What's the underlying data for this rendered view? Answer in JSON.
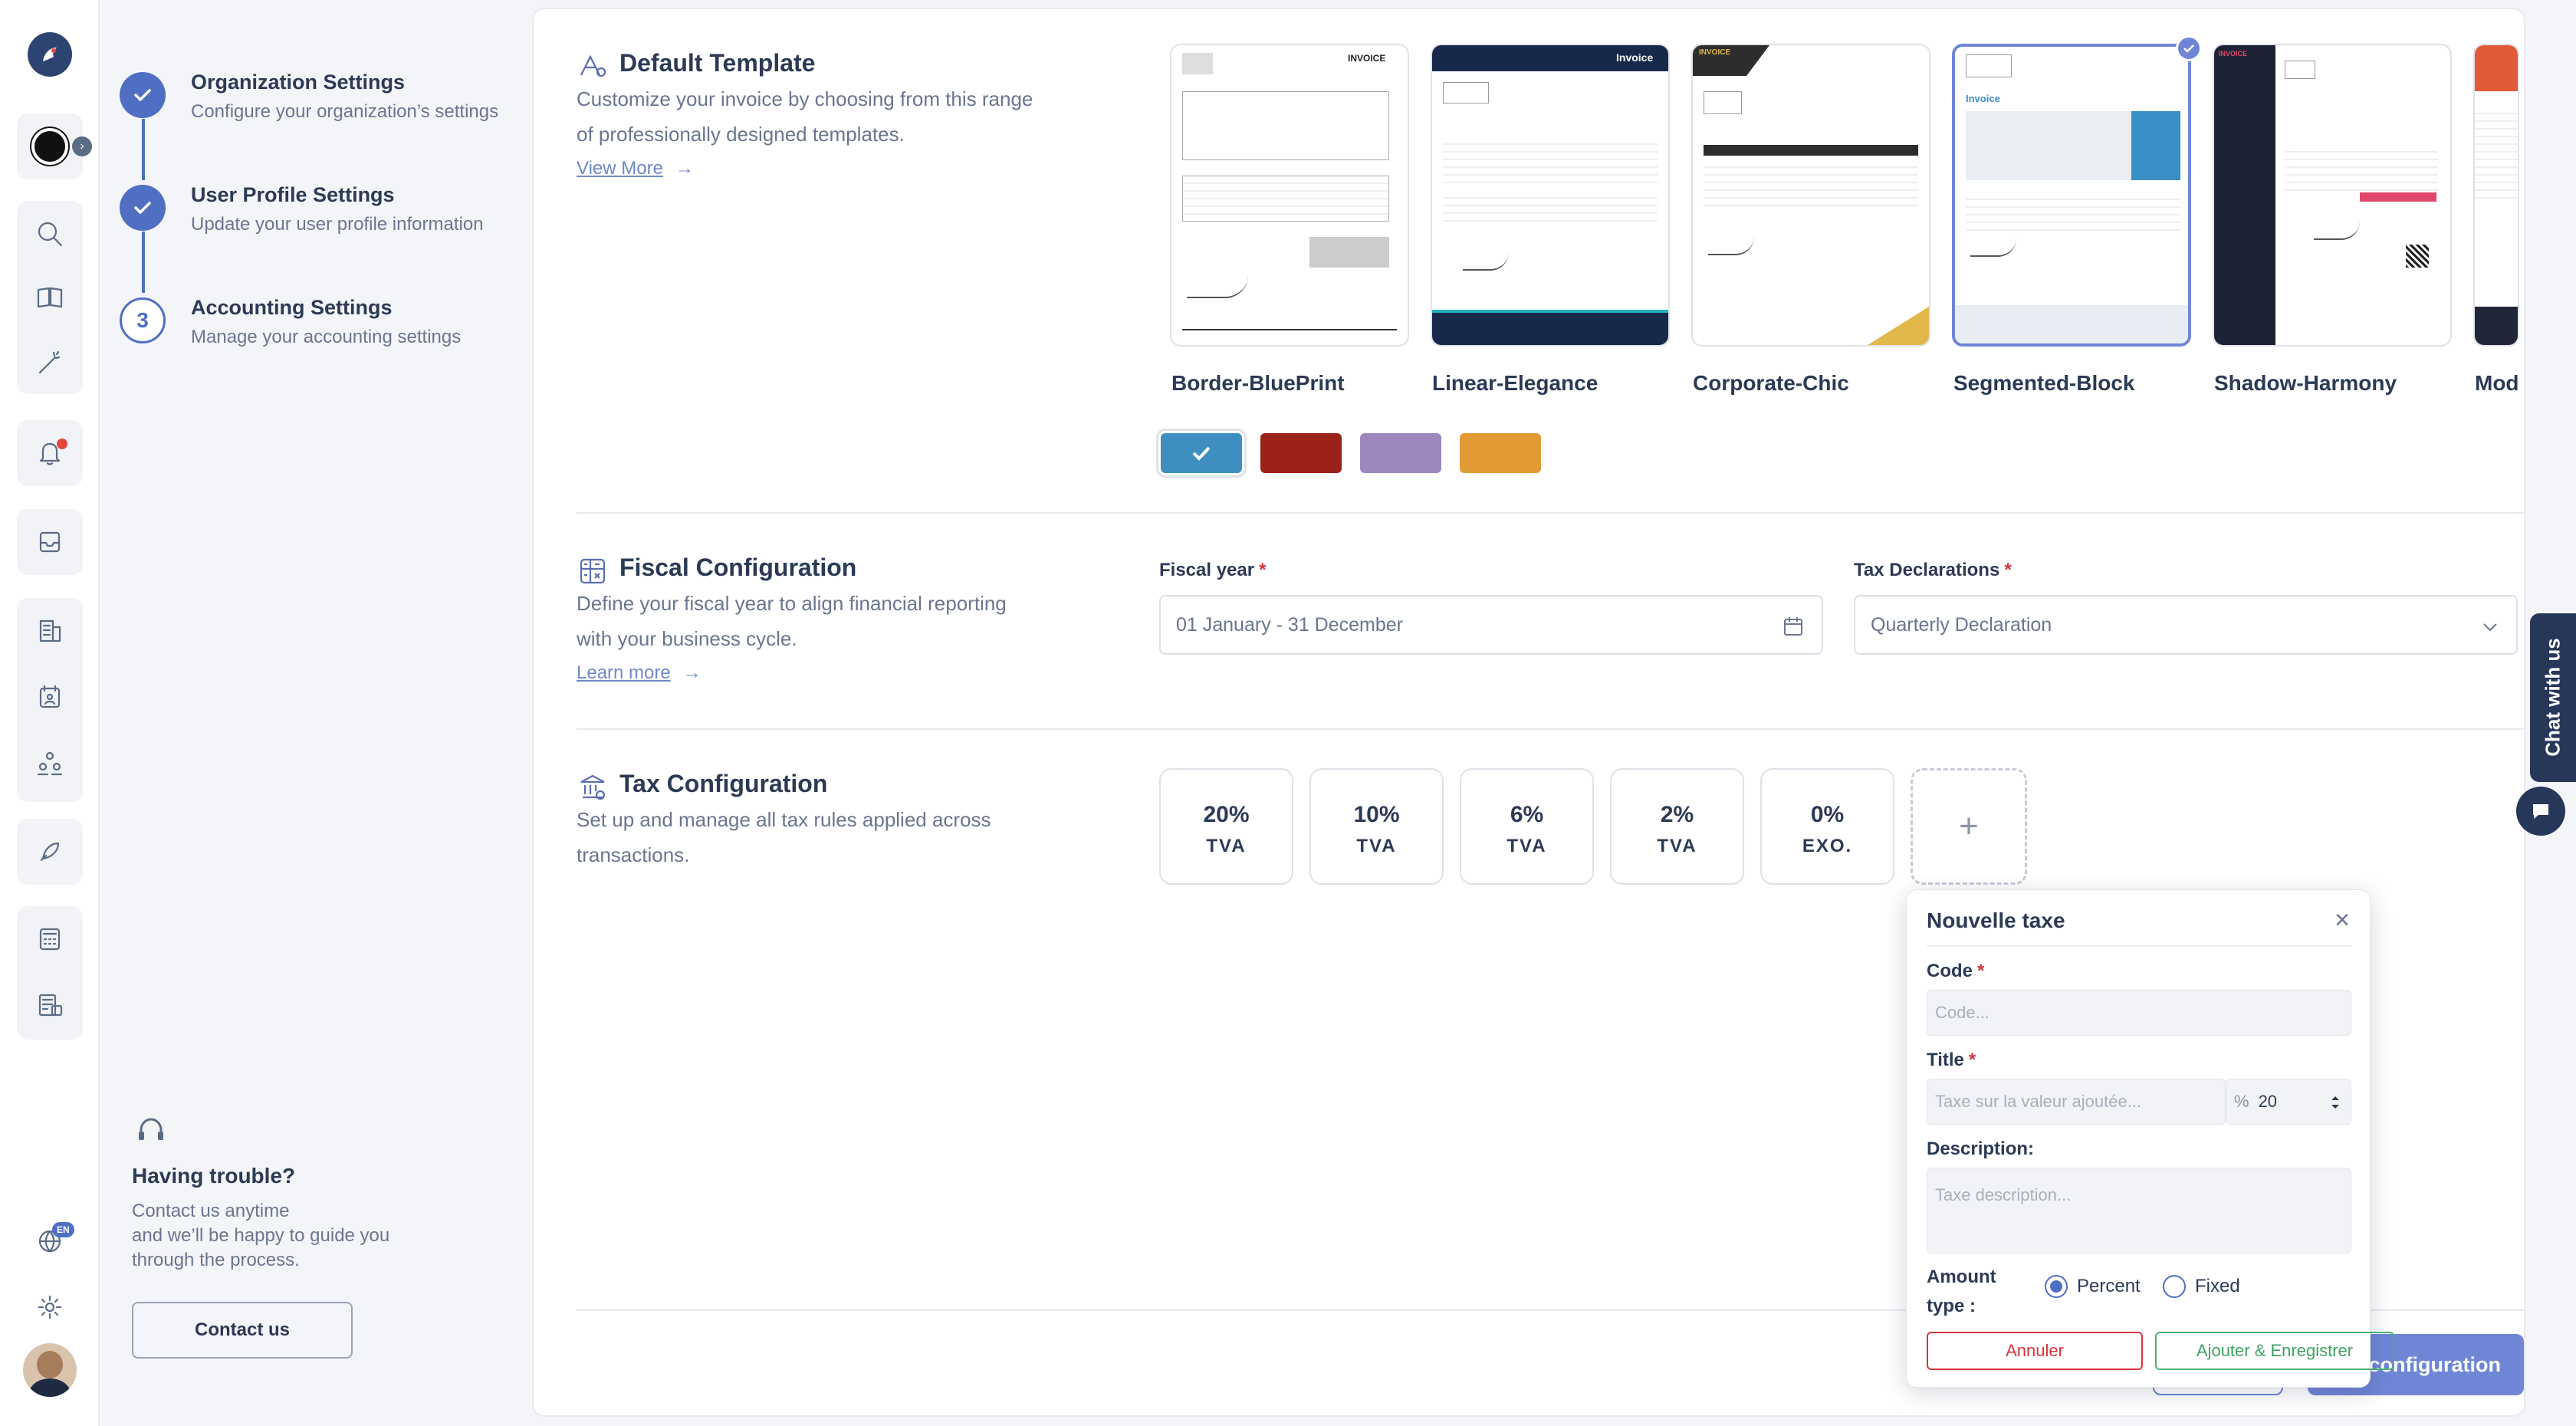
{
  "sidebar": {
    "lang_badge": "EN"
  },
  "steps": [
    {
      "title": "Organization Settings",
      "desc": "Configure your organization’s settings",
      "status": "done"
    },
    {
      "title": "User Profile Settings",
      "desc": "Update your user profile information",
      "status": "done"
    },
    {
      "title": "Accounting Settings",
      "desc": "Manage your accounting settings",
      "status": "current",
      "number": "3"
    }
  ],
  "help": {
    "title": "Having trouble?",
    "desc_line1": "Contact us anytime",
    "desc_line2": "and we’ll be happy to guide you",
    "desc_line3": "through the process.",
    "button": "Contact us"
  },
  "default_template": {
    "title": "Default Template",
    "desc_line1": "Customize your invoice by choosing from this range",
    "desc_line2": "of professionally designed templates.",
    "link": "View More",
    "templates": [
      {
        "name": "Border-BluePrint",
        "header": "INVOICE",
        "selected": false
      },
      {
        "name": "Linear-Elegance",
        "header": "Invoice",
        "selected": false
      },
      {
        "name": "Corporate-Chic",
        "header": "INVOICE",
        "selected": false
      },
      {
        "name": "Segmented-Block",
        "header": "Invoice",
        "selected": true
      },
      {
        "name": "Shadow-Harmony",
        "header": "INVOICE",
        "selected": false
      },
      {
        "name": "Mod",
        "header": "",
        "selected": false
      }
    ],
    "swatches": [
      "#3e8fc0",
      "#9b2218",
      "#9d87bd",
      "#e29a35"
    ],
    "selected_swatch": 0
  },
  "fiscal": {
    "title": "Fiscal Configuration",
    "desc_line1": "Define your fiscal year to align financial reporting",
    "desc_line2": "with your business cycle.",
    "link": "Learn more",
    "year_label": "Fiscal year",
    "year_value": "01 January - 31 December",
    "tax_label": "Tax Declarations",
    "tax_value": "Quarterly Declaration",
    "required_mark": "*"
  },
  "tax": {
    "title": "Tax Configuration",
    "desc_line1": "Set up and manage all tax rules applied across",
    "desc_line2": "transactions.",
    "rates": [
      {
        "pct": "20%",
        "label": "TVA"
      },
      {
        "pct": "10%",
        "label": "TVA"
      },
      {
        "pct": "6%",
        "label": "TVA"
      },
      {
        "pct": "2%",
        "label": "TVA"
      },
      {
        "pct": "0%",
        "label": "EXO."
      }
    ],
    "add": "+"
  },
  "popover": {
    "title": "Nouvelle taxe",
    "close": "×",
    "code_label": "Code",
    "code_placeholder": "Code...",
    "title_label": "Title",
    "title_placeholder": "Taxe sur la valeur ajoutée...",
    "pct_symbol": "%",
    "pct_value": "20",
    "desc_label": "Description:",
    "desc_placeholder": "Taxe description...",
    "amount_type_line1": "Amount",
    "amount_type_line2": "type :",
    "opt_percent": "Percent",
    "opt_fixed": "Fixed",
    "cancel": "Annuler",
    "save": "Ajouter & Enregistrer",
    "required_mark": "*"
  },
  "footer": {
    "save_config": "configuration"
  },
  "chat": {
    "label": "Chat with us"
  }
}
